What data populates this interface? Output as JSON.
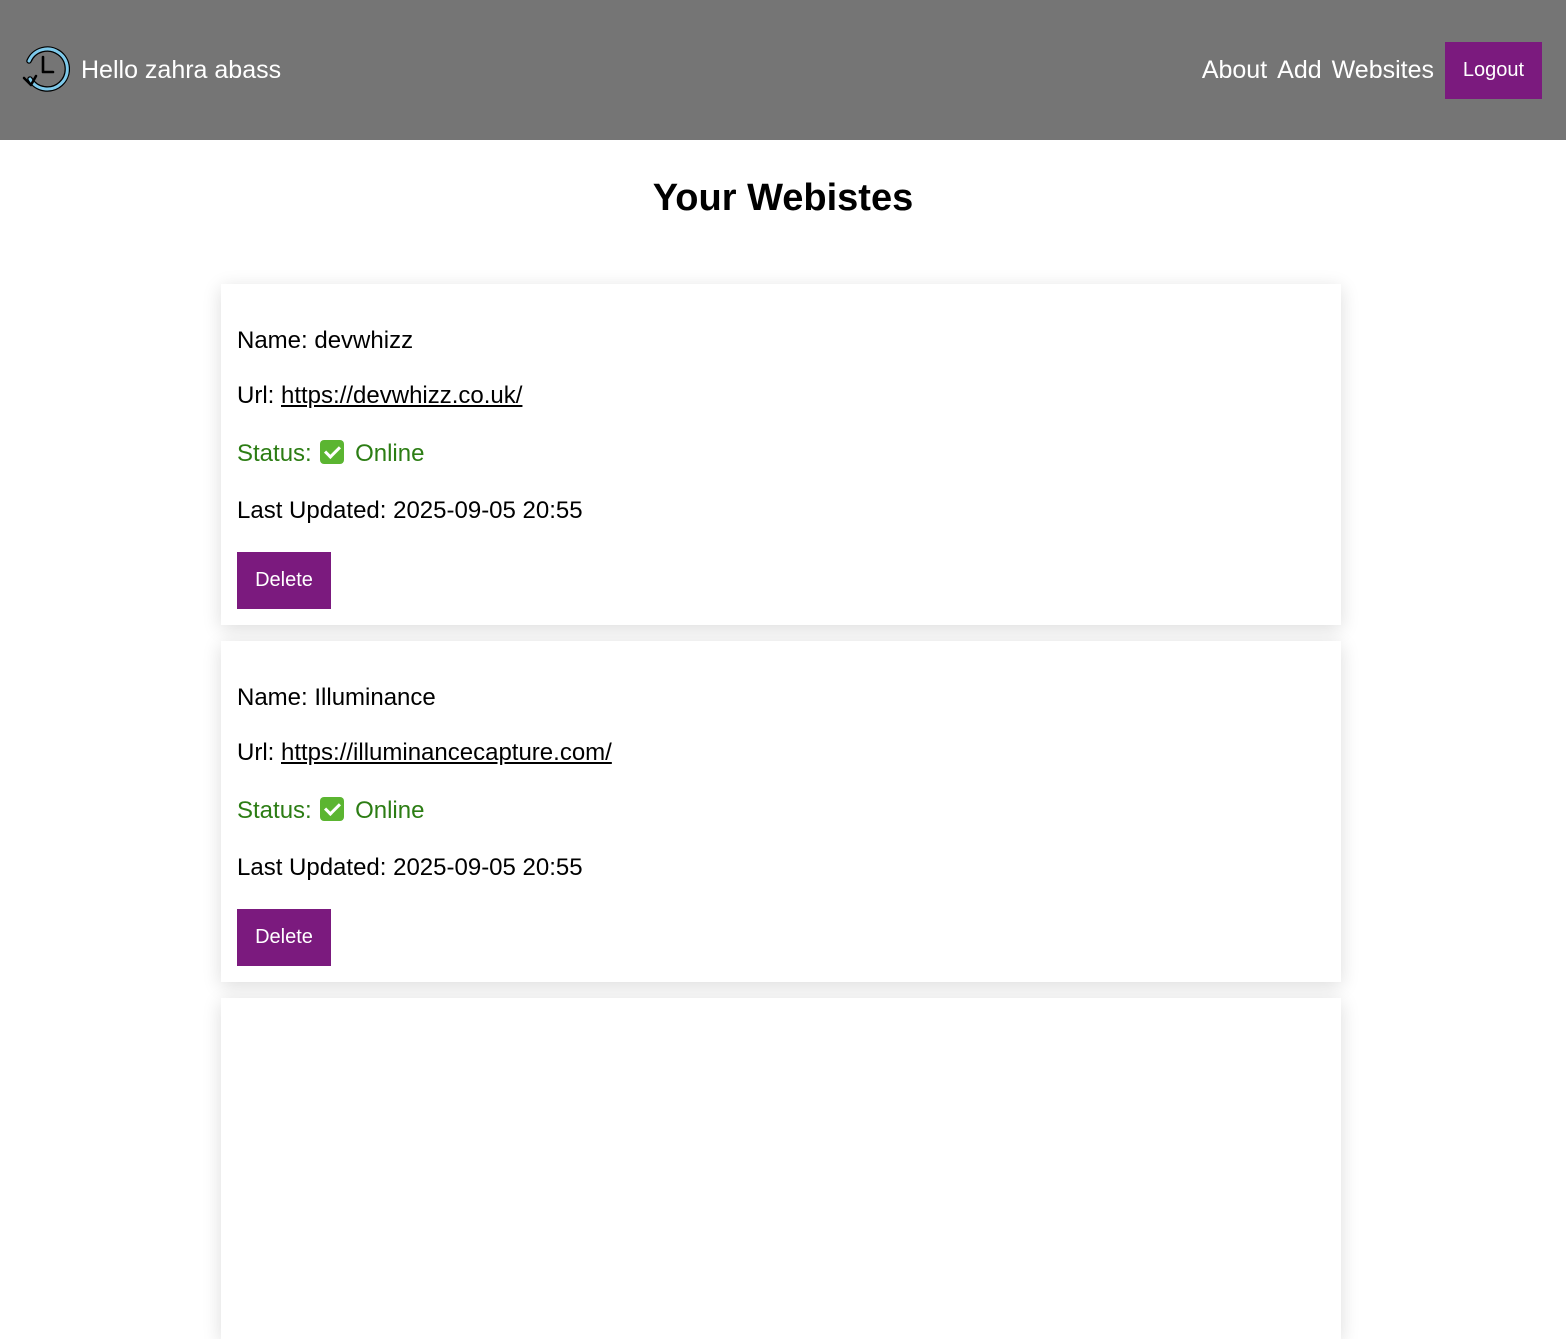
{
  "header": {
    "logo_icon": "history-clock-icon",
    "greeting": "Hello zahra abass",
    "nav": {
      "about": "About",
      "add": "Add",
      "websites": "Websites"
    },
    "logout_label": "Logout",
    "background_color": "#757575",
    "accent_color": "#7b1a7e"
  },
  "page": {
    "title": "Your Webistes"
  },
  "websites": [
    {
      "name_label": "Name:",
      "name": "devwhizz",
      "url_label": "Url:",
      "url": "https://devwhizz.co.uk/",
      "status_label": "Status:",
      "status_icon": "check-mark-icon",
      "status": "Online",
      "status_color": "#2c7d14",
      "updated_label": "Last Updated:",
      "updated": "2025-09-05 20:55",
      "delete_label": "Delete"
    },
    {
      "name_label": "Name:",
      "name": "Illuminance",
      "url_label": "Url:",
      "url": "https://illuminancecapture.com/",
      "status_label": "Status:",
      "status_icon": "check-mark-icon",
      "status": "Online",
      "status_color": "#2c7d14",
      "updated_label": "Last Updated:",
      "updated": "2025-09-05 20:55",
      "delete_label": "Delete"
    }
  ]
}
